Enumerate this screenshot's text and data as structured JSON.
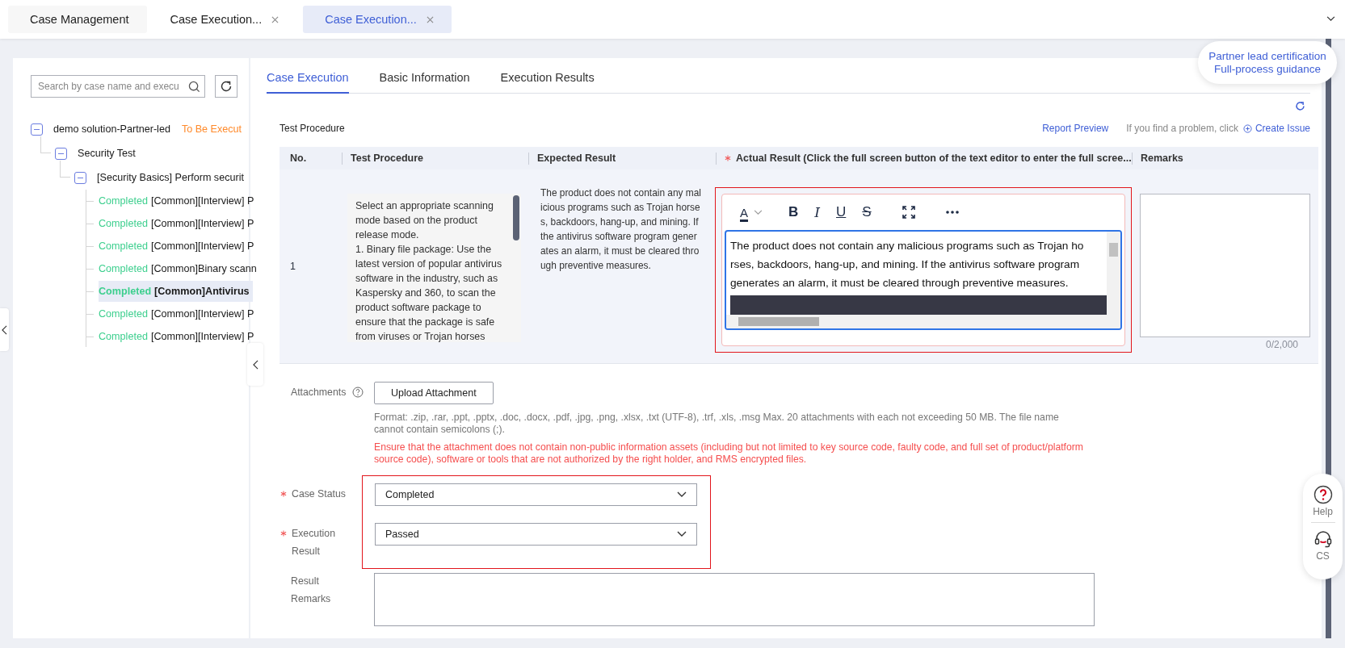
{
  "tabs": [
    {
      "label": "Case Management",
      "closable": false,
      "selected": false
    },
    {
      "label": "Case Execution...",
      "closable": true,
      "selected": false
    },
    {
      "label": "Case Execution...",
      "closable": true,
      "selected": true
    }
  ],
  "sidebar": {
    "search": {
      "placeholder": "Search by case name and execu"
    },
    "tree": [
      {
        "label": "demo solution-Partner-led",
        "status": "To Be Execut",
        "color": "#ff8a2b",
        "expanded": true,
        "children": [
          {
            "label": "Security Test",
            "expanded": true,
            "children": [
              {
                "label": "[Security Basics] Perform securit",
                "expanded": true,
                "children": [
                  {
                    "status": "Completed",
                    "color": "#3dcf8e",
                    "label": "[Common][Interview] P",
                    "selected": false
                  },
                  {
                    "status": "Completed",
                    "color": "#3dcf8e",
                    "label": "[Common][Interview] P",
                    "selected": false
                  },
                  {
                    "status": "Completed",
                    "color": "#3dcf8e",
                    "label": "[Common][Interview] P",
                    "selected": false
                  },
                  {
                    "status": "Completed",
                    "color": "#3dcf8e",
                    "label": "[Common]Binary scann",
                    "selected": false
                  },
                  {
                    "status": "Completed",
                    "color": "#3dcf8e",
                    "label": "[Common]Antivirus",
                    "selected": true
                  },
                  {
                    "status": "Completed",
                    "color": "#3dcf8e",
                    "label": "[Common][Interview] P",
                    "selected": false
                  },
                  {
                    "status": "Completed",
                    "color": "#3dcf8e",
                    "label": "[Common][Interview] P",
                    "selected": false
                  }
                ]
              }
            ]
          }
        ]
      }
    ]
  },
  "content_tabs": [
    {
      "label": "Case Execution",
      "selected": true
    },
    {
      "label": "Basic Information",
      "selected": false
    },
    {
      "label": "Execution Results",
      "selected": false
    }
  ],
  "guidance": {
    "lines": [
      "Partner lead certification",
      "Full-process guidance"
    ]
  },
  "section": {
    "title": "Test Procedure",
    "report_preview": "Report Preview",
    "issue_hint": "If you find a problem, click",
    "create_issue": "Create Issue"
  },
  "table": {
    "columns": [
      {
        "label": "No.",
        "required": false
      },
      {
        "label": "Test Procedure",
        "required": false
      },
      {
        "label": "Expected Result",
        "required": false
      },
      {
        "label": "Actual Result (Click the full screen button of the text editor to enter the full scree...",
        "required": true
      },
      {
        "label": "Remarks",
        "required": false
      }
    ],
    "rows": [
      {
        "no": "1",
        "procedure": "Select an appropriate scanning mode based on the product release mode.\n1. Binary file package: Use the latest version of popular antivirus software in the industry, such as Kaspersky and 360, to scan the product software package to ensure that the package is safe from viruses or Trojan horses",
        "expected": "The product does not contain any malicious programs such as Trojan horses, backdoors, hang-up, and mining. If the antivirus software program generates an alarm, it must be cleared through preventive measures.",
        "actual": "The product does not contain any malicious programs such as Trojan horses, backdoors, hang-up, and mining. If the antivirus software program generates an alarm, it must be cleared through preventive measures.",
        "remarks_count": "0/2,000",
        "highlighted": true,
        "toolbar": [
          {
            "kind": "color",
            "glyph": "A"
          },
          {
            "kind": "bold",
            "glyph": "B"
          },
          {
            "kind": "italic",
            "glyph": "I"
          },
          {
            "kind": "underline",
            "glyph": "U"
          },
          {
            "kind": "strike",
            "glyph": "S"
          },
          {
            "kind": "fullscreen"
          },
          {
            "kind": "more"
          }
        ]
      }
    ]
  },
  "attachments": {
    "label": "Attachments",
    "button": "Upload Attachment",
    "note": "Format: .zip, .rar, .ppt, .pptx, .doc, .docx, .pdf, .jpg, .png, .xlsx, .txt (UTF-8), .trf, .xls, .msg Max. 20 attachments with each not exceeding 50 MB. The file name cannot contain semicolons (;).",
    "warning": "Ensure that the attachment does not contain non-public information assets (including but not limited to key source code, faulty code, and full set of product/platform source code), software or tools that are not authorized by the right holder, and RMS encrypted files."
  },
  "form": {
    "highlighted": true,
    "fields": [
      {
        "label": "Case Status",
        "required": true,
        "value": "Completed"
      },
      {
        "label": "Execution Result",
        "required": true,
        "value": "Passed"
      }
    ],
    "remarks": {
      "label": "Result Remarks"
    }
  },
  "help_widget": [
    {
      "kind": "help",
      "label": "Help"
    },
    {
      "kind": "support",
      "label": "CS"
    }
  ]
}
